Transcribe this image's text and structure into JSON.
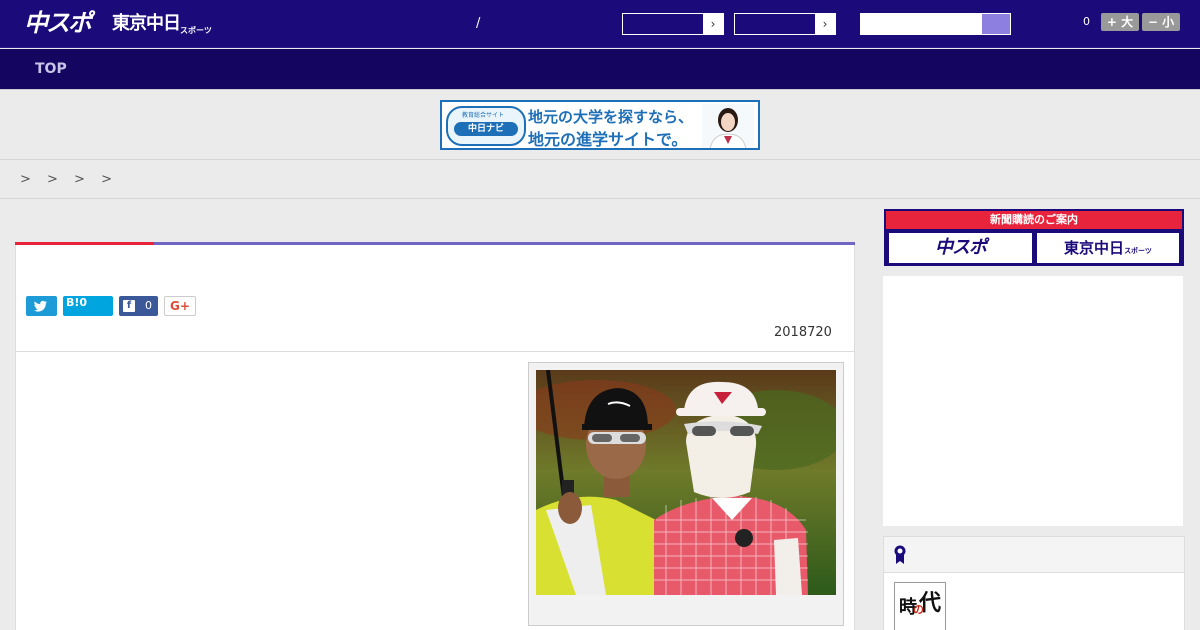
{
  "header": {
    "logo_chuspo": "中スポ",
    "logo_tokyo": "東京中日",
    "logo_tokyo_suffix": "スポーツ",
    "slash": "/",
    "select_arrow": "›",
    "count": "0",
    "font_up_label": "+ 大",
    "font_down_label": "− 小"
  },
  "nav": {
    "top_label": "TOP"
  },
  "banner": {
    "badge_small": "教育総合サイト",
    "badge_name": "中日ナビ",
    "line1": "地元の大学を探すなら、",
    "line2": "地元の進学サイトで。"
  },
  "breadcrumb": {
    "text": "> > > >"
  },
  "article": {
    "share_hatena": "B!0",
    "share_fb_icon": "f",
    "share_fb_count": "0",
    "share_gplus": "G+",
    "date": "2018720"
  },
  "sidebar": {
    "subscribe_heading": "新聞購読のご案内",
    "subscribe_chuspo": "中スポ",
    "subscribe_tokyo": "東京中日",
    "subscribe_tokyo_suffix": "スポーツ",
    "rank_thumb_k1": "時",
    "rank_thumb_k2": "代",
    "rank_thumb_kr": "の"
  },
  "colors": {
    "header_bg": "#1a0a7a",
    "nav_bg": "#130560",
    "accent_red": "#e8243c",
    "accent_purple": "#7065c4"
  }
}
